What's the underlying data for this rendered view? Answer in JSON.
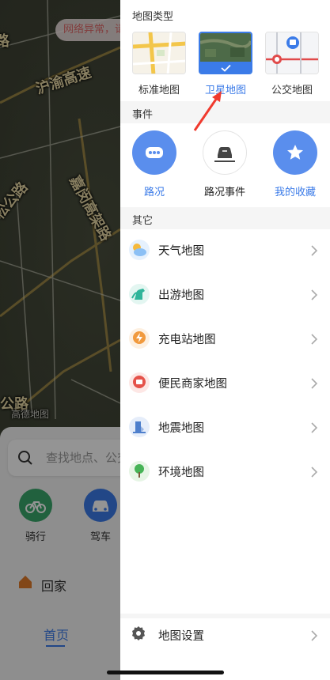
{
  "map": {
    "notice": "网络异常，请",
    "labels": [
      "沪渝高速",
      "嘉闵高架路",
      "松公路",
      "路",
      "公路"
    ],
    "watermark": "高德地图"
  },
  "bottom_sheet": {
    "search_placeholder": "查找地点、公交",
    "quick": [
      {
        "label": "骑行",
        "color": "#3aa86b",
        "icon": "bike-icon"
      },
      {
        "label": "驾车",
        "color": "#3b7be8",
        "icon": "car-icon"
      }
    ],
    "home_label": "回家",
    "tab_home": "首页"
  },
  "drawer": {
    "map_type_title": "地图类型",
    "map_types": [
      {
        "label": "标准地图",
        "selected": false,
        "icon": "standard-map-thumbnail"
      },
      {
        "label": "卫星地图",
        "selected": true,
        "icon": "satellite-map-thumbnail"
      },
      {
        "label": "公交地图",
        "selected": false,
        "icon": "transit-map-thumbnail"
      }
    ],
    "events_title": "事件",
    "events": [
      {
        "label": "路况",
        "icon": "traffic-icon",
        "active": true
      },
      {
        "label": "路况事件",
        "icon": "road-event-icon",
        "active": false
      },
      {
        "label": "我的收藏",
        "icon": "star-icon",
        "active": true
      }
    ],
    "other_title": "其它",
    "others": [
      {
        "label": "天气地图",
        "icon": "weather-icon",
        "color": "#5aa2f0"
      },
      {
        "label": "出游地图",
        "icon": "horse-icon",
        "color": "#2fb59a"
      },
      {
        "label": "充电站地图",
        "icon": "charging-icon",
        "color": "#f19a3e"
      },
      {
        "label": "便民商家地图",
        "icon": "merchant-icon",
        "color": "#e5524a"
      },
      {
        "label": "地震地图",
        "icon": "earthquake-icon",
        "color": "#4e7fcc"
      },
      {
        "label": "环境地图",
        "icon": "tree-icon",
        "color": "#46b356"
      }
    ],
    "settings_label": "地图设置"
  },
  "colors": {
    "accent": "#3b7be8"
  }
}
